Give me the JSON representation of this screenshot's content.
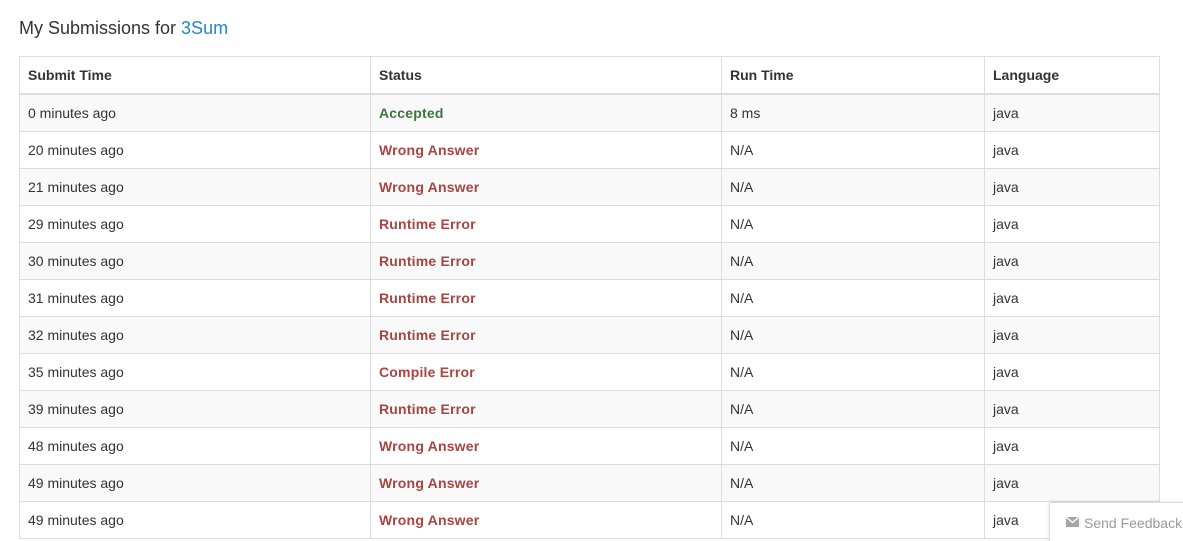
{
  "header": {
    "prefix": "My Submissions for ",
    "problem": "3Sum"
  },
  "table": {
    "columns": [
      "Submit Time",
      "Status",
      "Run Time",
      "Language"
    ],
    "rows": [
      {
        "time": "0 minutes ago",
        "status": "Accepted",
        "runtime": "8 ms",
        "language": "java"
      },
      {
        "time": "20 minutes ago",
        "status": "Wrong Answer",
        "runtime": "N/A",
        "language": "java"
      },
      {
        "time": "21 minutes ago",
        "status": "Wrong Answer",
        "runtime": "N/A",
        "language": "java"
      },
      {
        "time": "29 minutes ago",
        "status": "Runtime Error",
        "runtime": "N/A",
        "language": "java"
      },
      {
        "time": "30 minutes ago",
        "status": "Runtime Error",
        "runtime": "N/A",
        "language": "java"
      },
      {
        "time": "31 minutes ago",
        "status": "Runtime Error",
        "runtime": "N/A",
        "language": "java"
      },
      {
        "time": "32 minutes ago",
        "status": "Runtime Error",
        "runtime": "N/A",
        "language": "java"
      },
      {
        "time": "35 minutes ago",
        "status": "Compile Error",
        "runtime": "N/A",
        "language": "java"
      },
      {
        "time": "39 minutes ago",
        "status": "Runtime Error",
        "runtime": "N/A",
        "language": "java"
      },
      {
        "time": "48 minutes ago",
        "status": "Wrong Answer",
        "runtime": "N/A",
        "language": "java"
      },
      {
        "time": "49 minutes ago",
        "status": "Wrong Answer",
        "runtime": "N/A",
        "language": "java"
      },
      {
        "time": "49 minutes ago",
        "status": "Wrong Answer",
        "runtime": "N/A",
        "language": "java"
      }
    ]
  },
  "feedback": {
    "label": "Send Feedback",
    "icon": "envelope-icon"
  },
  "colors": {
    "link": "#1a8ad0",
    "accepted": "#3c763d",
    "error": "#a94442",
    "row_stripe": "#f9f9f9",
    "border": "#dddddd"
  }
}
